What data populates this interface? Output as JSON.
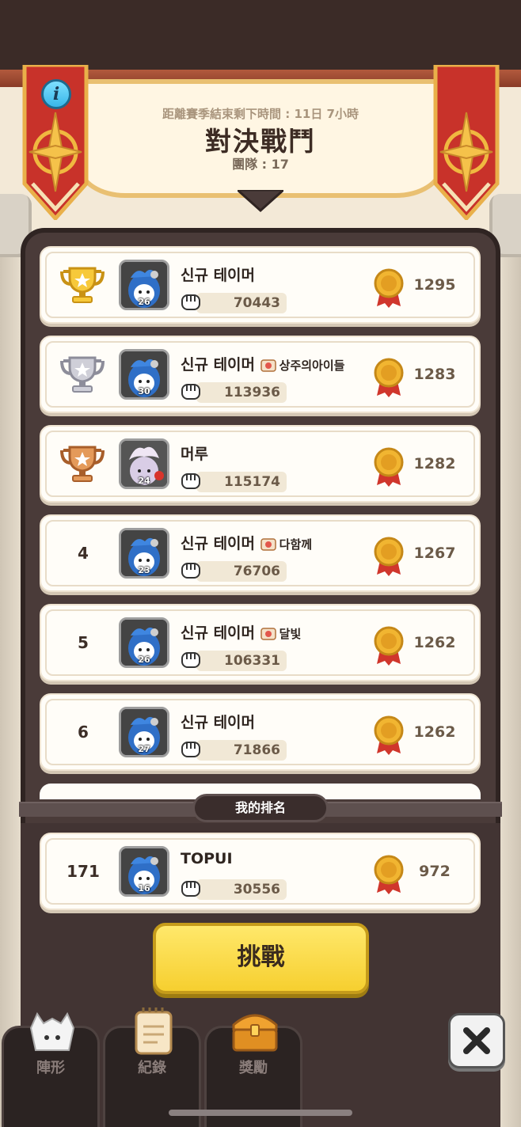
{
  "header": {
    "season_remaining": "距離賽季結束剩下時間 : 11日 7小時",
    "title": "對決戰鬥",
    "team": "團隊 : 17",
    "info_label": "i"
  },
  "rankings": [
    {
      "rank": "1",
      "trophy": "gold",
      "name": "신규 테이머",
      "guild": "",
      "guild_icon": "",
      "level": "26",
      "power": "70443",
      "score": "1295"
    },
    {
      "rank": "2",
      "trophy": "silver",
      "name": "신규 테이머",
      "guild": "상주의아이들",
      "guild_icon": "chef-guild-icon",
      "level": "30",
      "power": "113936",
      "score": "1283"
    },
    {
      "rank": "3",
      "trophy": "bronze",
      "name": "머루",
      "guild": "",
      "guild_icon": "",
      "level": "24",
      "power": "115174",
      "score": "1282"
    },
    {
      "rank": "4",
      "trophy": "",
      "name": "신규 테이머",
      "guild": "다함께",
      "guild_icon": "bird-guild-icon",
      "level": "23",
      "power": "76706",
      "score": "1267"
    },
    {
      "rank": "5",
      "trophy": "",
      "name": "신규 테이머",
      "guild": "달빛",
      "guild_icon": "bird-guild-icon",
      "level": "26",
      "power": "106331",
      "score": "1262"
    },
    {
      "rank": "6",
      "trophy": "",
      "name": "신규 테이머",
      "guild": "",
      "guild_icon": "",
      "level": "27",
      "power": "71866",
      "score": "1262"
    }
  ],
  "my_rank": {
    "label": "我的排名",
    "rank": "171",
    "name": "TOPUI",
    "level": "16",
    "power": "30556",
    "score": "972"
  },
  "challenge_label": "挑戰",
  "tabs": [
    {
      "label": "陣形",
      "icon": "formation-icon"
    },
    {
      "label": "紀錄",
      "icon": "record-icon"
    },
    {
      "label": "獎勵",
      "icon": "treasure-chest-icon"
    }
  ],
  "colors": {
    "accent_yellow": "#f6cf2f",
    "banner_red": "#c8322a",
    "gold": "#e8b23a"
  }
}
